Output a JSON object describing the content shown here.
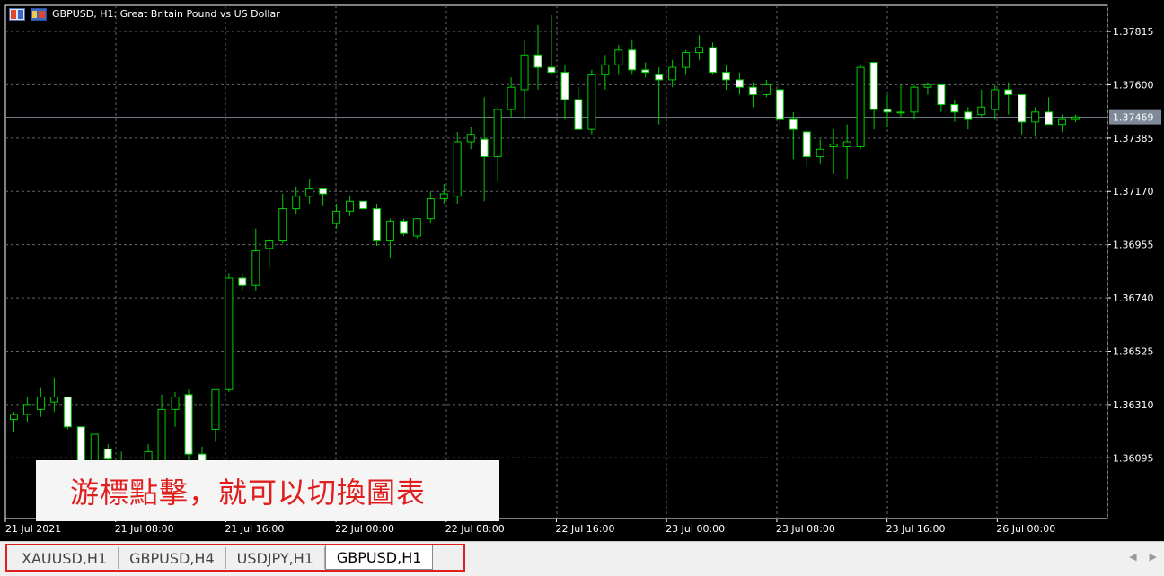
{
  "chart": {
    "title": "GBPUSD, H1:  Great Britain Pound vs US Dollar",
    "symbol": "GBPUSD",
    "timeframe": "H1",
    "colors": {
      "background": "#000000",
      "grid": "#666666",
      "candle_outline": "#00cc00",
      "bull_body": "#000000",
      "bear_body": "#ffffff",
      "axis_text": "#ffffff",
      "current_price_line": "#7f8a99",
      "current_price_label_bg": "#7f8a99"
    },
    "current_price": "1.37469",
    "price_ticks": [
      "1.37815",
      "1.37600",
      "1.37385",
      "1.37170",
      "1.36955",
      "1.36740",
      "1.36525",
      "1.36310",
      "1.36095"
    ],
    "time_ticks": [
      "21 Jul 2021",
      "21 Jul 08:00",
      "21 Jul 16:00",
      "22 Jul 00:00",
      "22 Jul 08:00",
      "22 Jul 16:00",
      "23 Jul 00:00",
      "23 Jul 08:00",
      "23 Jul 16:00",
      "26 Jul 00:00"
    ]
  },
  "chart_data": {
    "type": "candlestick",
    "title": "GBPUSD, H1:  Great Britain Pound vs US Dollar",
    "ylim": [
      1.3585,
      1.3792
    ],
    "y_ticks": [
      1.37815,
      1.376,
      1.37385,
      1.3717,
      1.36955,
      1.3674,
      1.36525,
      1.3631,
      1.36095
    ],
    "current_price": 1.37469,
    "candles": [
      {
        "o": 1.3625,
        "h": 1.3628,
        "l": 1.362,
        "c": 1.3627
      },
      {
        "o": 1.3627,
        "h": 1.3634,
        "l": 1.3624,
        "c": 1.3631
      },
      {
        "o": 1.3629,
        "h": 1.3638,
        "l": 1.3626,
        "c": 1.3634
      },
      {
        "o": 1.3632,
        "h": 1.3642,
        "l": 1.3628,
        "c": 1.3634
      },
      {
        "o": 1.3634,
        "h": 1.3634,
        "l": 1.3621,
        "c": 1.3622
      },
      {
        "o": 1.3622,
        "h": 1.3622,
        "l": 1.3597,
        "c": 1.3599
      },
      {
        "o": 1.3599,
        "h": 1.3616,
        "l": 1.3594,
        "c": 1.3619
      },
      {
        "o": 1.3613,
        "h": 1.3615,
        "l": 1.3603,
        "c": 1.3609
      },
      {
        "o": 1.3608,
        "h": 1.3612,
        "l": 1.3601,
        "c": 1.3604
      },
      {
        "o": 1.3604,
        "h": 1.3608,
        "l": 1.3597,
        "c": 1.3607
      },
      {
        "o": 1.3606,
        "h": 1.3615,
        "l": 1.36,
        "c": 1.3612
      },
      {
        "o": 1.3607,
        "h": 1.3635,
        "l": 1.3605,
        "c": 1.3629
      },
      {
        "o": 1.3629,
        "h": 1.3636,
        "l": 1.3622,
        "c": 1.3634
      },
      {
        "o": 1.3635,
        "h": 1.3637,
        "l": 1.3605,
        "c": 1.3611
      },
      {
        "o": 1.3611,
        "h": 1.3614,
        "l": 1.3598,
        "c": 1.3608
      },
      {
        "o": 1.3621,
        "h": 1.3637,
        "l": 1.3616,
        "c": 1.3637
      },
      {
        "o": 1.3637,
        "h": 1.3684,
        "l": 1.3636,
        "c": 1.3682
      },
      {
        "o": 1.3682,
        "h": 1.3684,
        "l": 1.3677,
        "c": 1.3679
      },
      {
        "o": 1.3679,
        "h": 1.3702,
        "l": 1.3677,
        "c": 1.3693
      },
      {
        "o": 1.3694,
        "h": 1.3698,
        "l": 1.3686,
        "c": 1.3697
      },
      {
        "o": 1.3697,
        "h": 1.3716,
        "l": 1.3696,
        "c": 1.371
      },
      {
        "o": 1.371,
        "h": 1.3719,
        "l": 1.3708,
        "c": 1.3715
      },
      {
        "o": 1.3715,
        "h": 1.3722,
        "l": 1.3712,
        "c": 1.3718
      },
      {
        "o": 1.3718,
        "h": 1.3718,
        "l": 1.3711,
        "c": 1.3716
      },
      {
        "o": 1.3704,
        "h": 1.3712,
        "l": 1.3702,
        "c": 1.3709
      },
      {
        "o": 1.3709,
        "h": 1.3715,
        "l": 1.3707,
        "c": 1.3713
      },
      {
        "o": 1.3713,
        "h": 1.3713,
        "l": 1.371,
        "c": 1.371
      },
      {
        "o": 1.371,
        "h": 1.3712,
        "l": 1.3695,
        "c": 1.3697
      },
      {
        "o": 1.3697,
        "h": 1.3706,
        "l": 1.369,
        "c": 1.3705
      },
      {
        "o": 1.3705,
        "h": 1.3706,
        "l": 1.3699,
        "c": 1.37
      },
      {
        "o": 1.3699,
        "h": 1.3706,
        "l": 1.3698,
        "c": 1.3706
      },
      {
        "o": 1.3706,
        "h": 1.3717,
        "l": 1.3704,
        "c": 1.3714
      },
      {
        "o": 1.3714,
        "h": 1.372,
        "l": 1.3712,
        "c": 1.3716
      },
      {
        "o": 1.3715,
        "h": 1.3741,
        "l": 1.3712,
        "c": 1.3737
      },
      {
        "o": 1.3737,
        "h": 1.3743,
        "l": 1.3734,
        "c": 1.374
      },
      {
        "o": 1.3738,
        "h": 1.3755,
        "l": 1.3713,
        "c": 1.3731
      },
      {
        "o": 1.3731,
        "h": 1.3751,
        "l": 1.3721,
        "c": 1.375
      },
      {
        "o": 1.375,
        "h": 1.3763,
        "l": 1.3747,
        "c": 1.3759
      },
      {
        "o": 1.3758,
        "h": 1.3778,
        "l": 1.3746,
        "c": 1.3772
      },
      {
        "o": 1.3772,
        "h": 1.3784,
        "l": 1.3758,
        "c": 1.3767
      },
      {
        "o": 1.3767,
        "h": 1.3788,
        "l": 1.3764,
        "c": 1.3765
      },
      {
        "o": 1.3765,
        "h": 1.3768,
        "l": 1.3746,
        "c": 1.3754
      },
      {
        "o": 1.3754,
        "h": 1.3759,
        "l": 1.3744,
        "c": 1.3742
      },
      {
        "o": 1.3742,
        "h": 1.3766,
        "l": 1.374,
        "c": 1.3764
      },
      {
        "o": 1.3764,
        "h": 1.3772,
        "l": 1.3758,
        "c": 1.3768
      },
      {
        "o": 1.3768,
        "h": 1.3776,
        "l": 1.3764,
        "c": 1.3774
      },
      {
        "o": 1.3774,
        "h": 1.3778,
        "l": 1.3764,
        "c": 1.3766
      },
      {
        "o": 1.3766,
        "h": 1.3769,
        "l": 1.3763,
        "c": 1.3765
      },
      {
        "o": 1.3764,
        "h": 1.3767,
        "l": 1.3744,
        "c": 1.3762
      },
      {
        "o": 1.3762,
        "h": 1.377,
        "l": 1.3759,
        "c": 1.3767
      },
      {
        "o": 1.3767,
        "h": 1.3774,
        "l": 1.3764,
        "c": 1.3773
      },
      {
        "o": 1.3773,
        "h": 1.378,
        "l": 1.377,
        "c": 1.3775
      },
      {
        "o": 1.3775,
        "h": 1.3777,
        "l": 1.3764,
        "c": 1.3765
      },
      {
        "o": 1.3765,
        "h": 1.3768,
        "l": 1.3758,
        "c": 1.3762
      },
      {
        "o": 1.3762,
        "h": 1.3765,
        "l": 1.3756,
        "c": 1.3759
      },
      {
        "o": 1.3759,
        "h": 1.3761,
        "l": 1.3751,
        "c": 1.3756
      },
      {
        "o": 1.3756,
        "h": 1.3762,
        "l": 1.3755,
        "c": 1.376
      },
      {
        "o": 1.3758,
        "h": 1.376,
        "l": 1.3744,
        "c": 1.3746
      },
      {
        "o": 1.3746,
        "h": 1.3749,
        "l": 1.373,
        "c": 1.3742
      },
      {
        "o": 1.3741,
        "h": 1.3742,
        "l": 1.3727,
        "c": 1.3731
      },
      {
        "o": 1.3731,
        "h": 1.3738,
        "l": 1.3728,
        "c": 1.3734
      },
      {
        "o": 1.3735,
        "h": 1.3742,
        "l": 1.3724,
        "c": 1.3736
      },
      {
        "o": 1.3735,
        "h": 1.3744,
        "l": 1.3722,
        "c": 1.3737
      },
      {
        "o": 1.3735,
        "h": 1.3768,
        "l": 1.3734,
        "c": 1.3767
      },
      {
        "o": 1.3769,
        "h": 1.3769,
        "l": 1.3742,
        "c": 1.375
      },
      {
        "o": 1.375,
        "h": 1.3756,
        "l": 1.3743,
        "c": 1.3749
      },
      {
        "o": 1.3749,
        "h": 1.376,
        "l": 1.3747,
        "c": 1.3749
      },
      {
        "o": 1.3749,
        "h": 1.376,
        "l": 1.3746,
        "c": 1.3759
      },
      {
        "o": 1.3759,
        "h": 1.3761,
        "l": 1.3756,
        "c": 1.376
      },
      {
        "o": 1.376,
        "h": 1.376,
        "l": 1.3749,
        "c": 1.3752
      },
      {
        "o": 1.3752,
        "h": 1.3754,
        "l": 1.3745,
        "c": 1.3749
      },
      {
        "o": 1.3749,
        "h": 1.3751,
        "l": 1.3742,
        "c": 1.3746
      },
      {
        "o": 1.3748,
        "h": 1.3758,
        "l": 1.3747,
        "c": 1.3751
      },
      {
        "o": 1.375,
        "h": 1.376,
        "l": 1.3746,
        "c": 1.3758
      },
      {
        "o": 1.3758,
        "h": 1.3761,
        "l": 1.3748,
        "c": 1.3756
      },
      {
        "o": 1.3756,
        "h": 1.3756,
        "l": 1.374,
        "c": 1.3745
      },
      {
        "o": 1.3745,
        "h": 1.3751,
        "l": 1.3739,
        "c": 1.3749
      },
      {
        "o": 1.3749,
        "h": 1.3755,
        "l": 1.3745,
        "c": 1.3744
      },
      {
        "o": 1.3744,
        "h": 1.3748,
        "l": 1.3741,
        "c": 1.3746
      },
      {
        "o": 1.3746,
        "h": 1.3748,
        "l": 1.3745,
        "c": 1.3747
      }
    ]
  },
  "overlay": {
    "text": "游標點擊，就可以切換圖表"
  },
  "tabs": [
    {
      "label": "XAUUSD,H1",
      "active": false
    },
    {
      "label": "GBPUSD,H4",
      "active": false
    },
    {
      "label": "USDJPY,H1",
      "active": false
    },
    {
      "label": "GBPUSD,H1",
      "active": true
    }
  ],
  "tab_scroll": {
    "left": "◀",
    "right": "▶"
  }
}
